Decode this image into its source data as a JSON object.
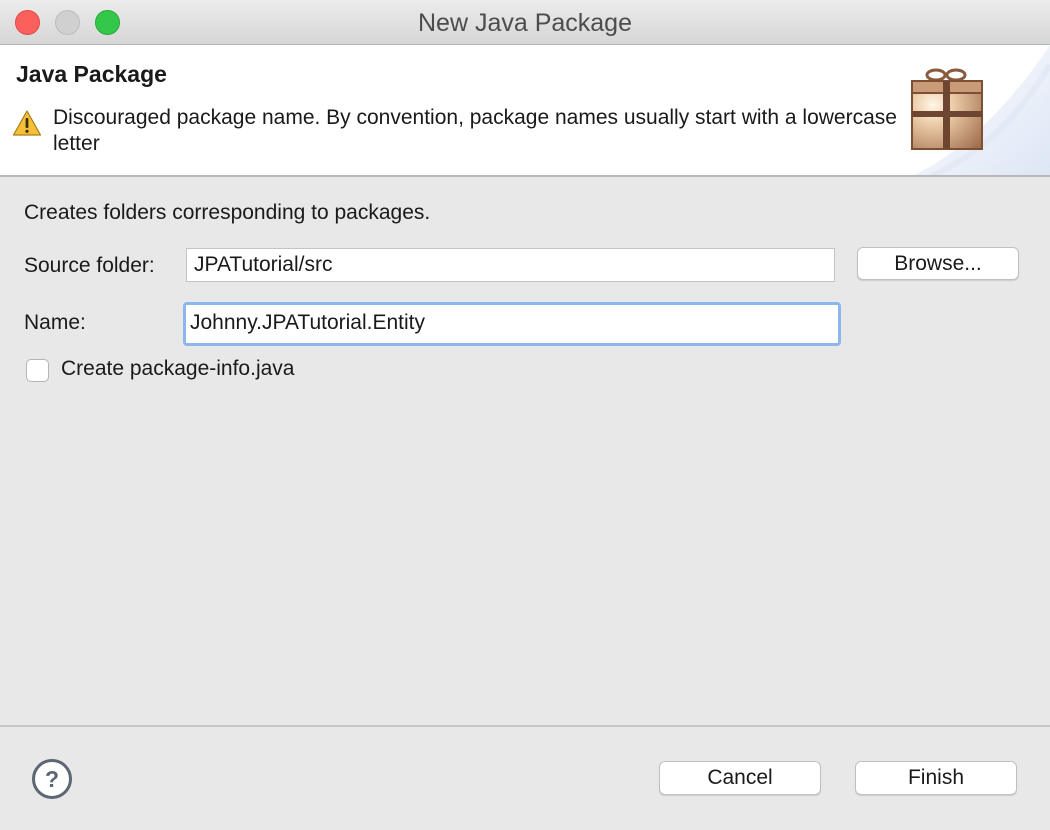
{
  "window": {
    "title": "New Java Package"
  },
  "banner": {
    "title": "Java Package",
    "message": "Discouraged package name. By convention, package names usually start with a lowercase letter",
    "warning_icon": "warning-triangle-icon",
    "image_icon": "package-icon"
  },
  "body": {
    "description": "Creates folders corresponding to packages.",
    "source_folder": {
      "label": "Source folder:",
      "value": "JPATutorial/src",
      "browse_label": "Browse..."
    },
    "name": {
      "label": "Name:",
      "value": "Johnny.JPATutorial.Entity"
    },
    "package_info": {
      "label": "Create package-info.java",
      "checked": false
    }
  },
  "footer": {
    "help_icon": "help-icon",
    "cancel_label": "Cancel",
    "finish_label": "Finish"
  },
  "colors": {
    "focus_ring": "#8cb6ee",
    "close_button": "#fc605c",
    "zoom_button": "#34c84a",
    "warning": "#f5c037"
  }
}
